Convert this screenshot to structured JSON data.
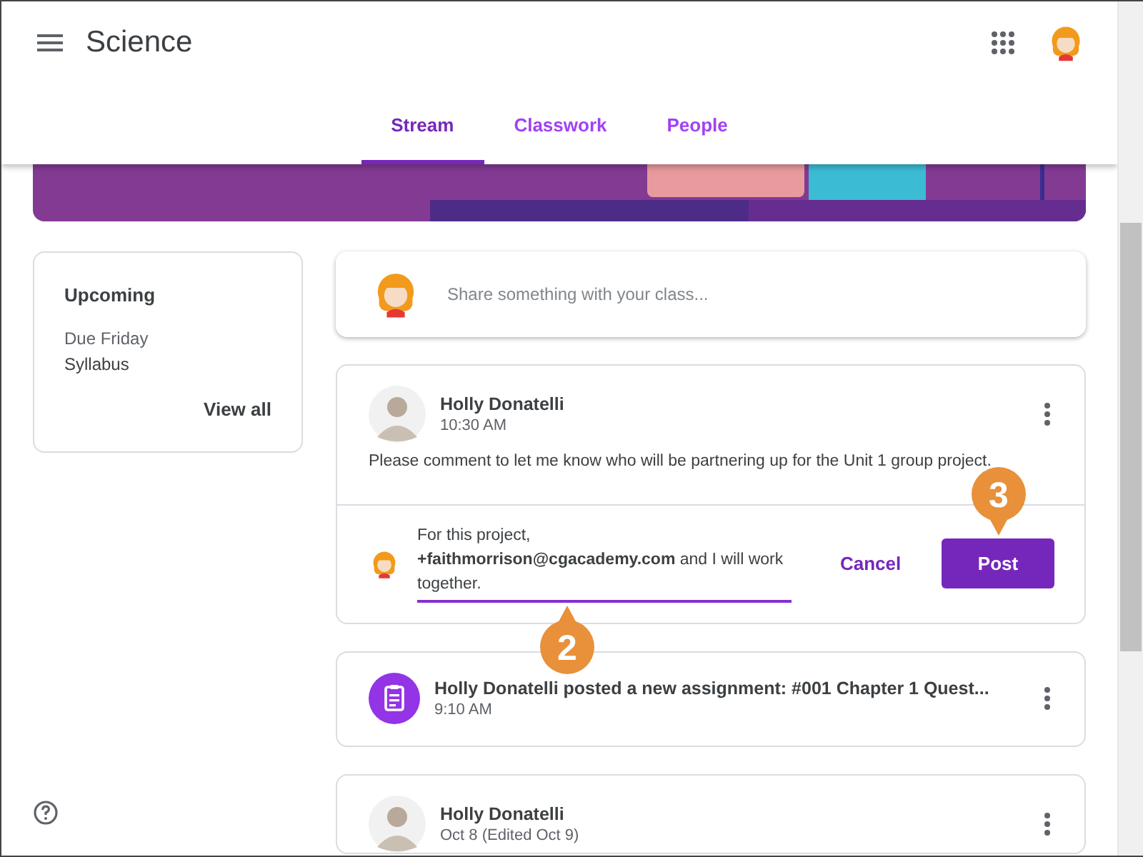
{
  "app_bar": {
    "title": "Science"
  },
  "tabs": [
    {
      "label": "Stream",
      "selected": true
    },
    {
      "label": "Classwork",
      "selected": false
    },
    {
      "label": "People",
      "selected": false
    }
  ],
  "upcoming": {
    "title": "Upcoming",
    "due": "Due Friday",
    "item": "Syllabus",
    "link": "View all"
  },
  "share_box": {
    "placeholder": "Share something with your class..."
  },
  "posts": [
    {
      "kind": "announcement",
      "author": "Holly Donatelli",
      "time": "10:30 AM",
      "text": "Please comment to let me know who will be partnering up for the Unit 1 group project.",
      "comment": {
        "value": "For this project, **+faithmorrison@cgacademy.com** and I will work together.",
        "cancel": "Cancel",
        "post": "Post"
      }
    },
    {
      "kind": "assignment",
      "title": "Holly Donatelli posted a new assignment: #001 Chapter 1 Quest...",
      "time": "9:10 AM"
    },
    {
      "kind": "announcement",
      "author": "Holly Donatelli",
      "time": "Oct 8 (Edited Oct 9)"
    }
  ],
  "callouts": [
    {
      "label": "2",
      "kind": "up"
    },
    {
      "label": "3",
      "kind": "down"
    }
  ]
}
